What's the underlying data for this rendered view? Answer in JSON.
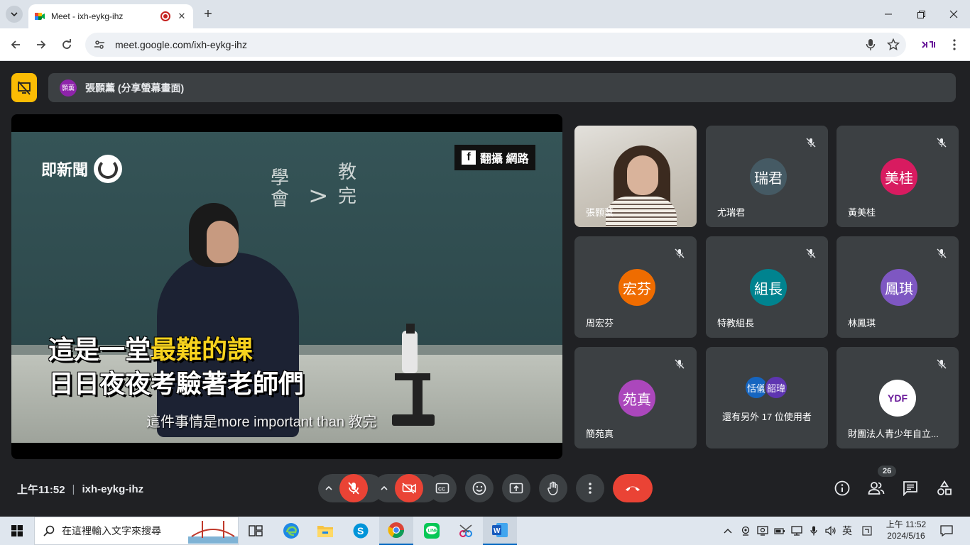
{
  "browser": {
    "tab_title": "Meet - ixh-eykg-ihz",
    "url": "meet.google.com/ixh-eykg-ihz"
  },
  "meet": {
    "presenter_initials": "顥薰",
    "presenter_label": "張顥薰 (分享螢幕畫面)",
    "video": {
      "brand": "即新聞",
      "source_tag": "翻攝 網路",
      "chalk_left": "學\n會",
      "chalk_right": "教\n完",
      "caption_line1_a": "這是一堂",
      "caption_line1_b": "最難的課",
      "caption_line2": "日日夜夜考驗著老師們",
      "subtitle": "這件事情是more important than 教完"
    },
    "tiles": [
      {
        "name": "張顥薰",
        "type": "camera"
      },
      {
        "name": "尤瑞君",
        "initials": "瑞君",
        "color": "#455a64"
      },
      {
        "name": "黃美桂",
        "initials": "美桂",
        "color": "#d81b60"
      },
      {
        "name": "周宏芬",
        "initials": "宏芬",
        "color": "#ef6c00"
      },
      {
        "name": "特教組長",
        "initials": "組長",
        "color": "#00838f"
      },
      {
        "name": "林鳳琪",
        "initials": "鳳琪",
        "color": "#7e57c2"
      },
      {
        "name": "簡苑真",
        "initials": "苑真",
        "color": "#ab47bc"
      },
      {
        "name": "財團法人青少年自立...",
        "initials": "YDF",
        "color": "#ffffff"
      }
    ],
    "more": {
      "avatar1": "恬儀",
      "avatar2": "韶瑋",
      "text": "還有另外 17 位使用者"
    },
    "time": "上午11:52",
    "meeting_code": "ixh-eykg-ihz",
    "participants_count": "26"
  },
  "taskbar": {
    "search_placeholder": "在這裡輸入文字來搜尋",
    "ime": "英",
    "clock_time": "上午 11:52",
    "clock_date": "2024/5/16"
  }
}
